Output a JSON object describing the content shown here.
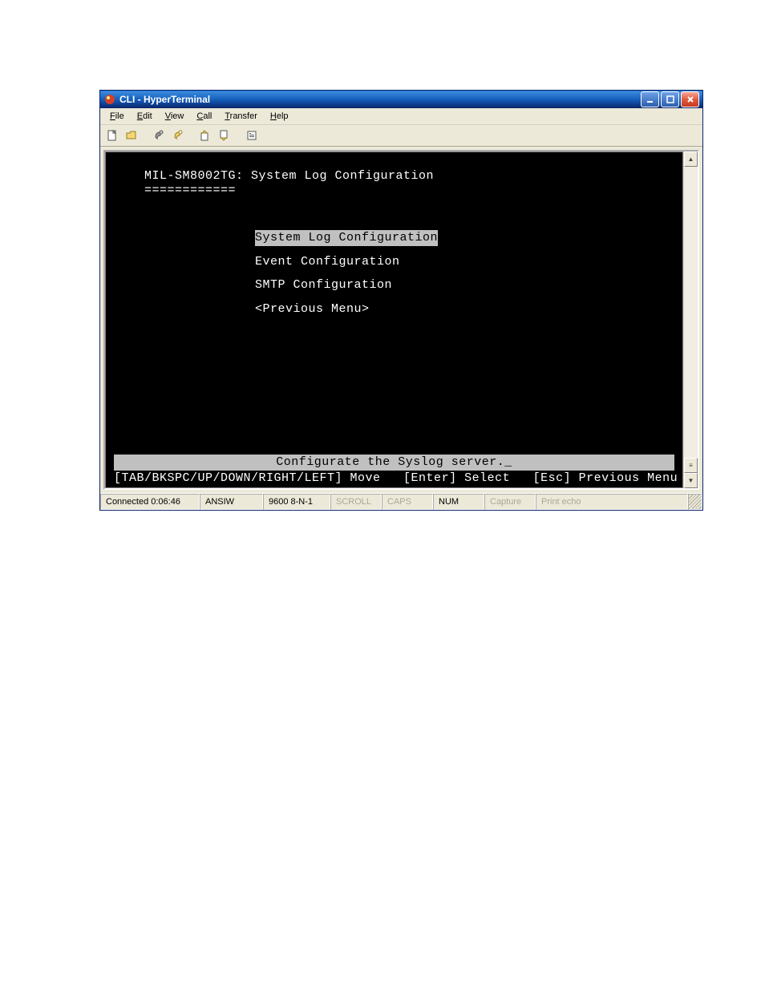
{
  "window": {
    "title": "CLI - HyperTerminal"
  },
  "menu": {
    "file": "File",
    "edit": "Edit",
    "view": "View",
    "call": "Call",
    "transfer": "Transfer",
    "help": "Help"
  },
  "terminal": {
    "header": "MIL-SM8002TG: System Log Configuration",
    "underline": "============",
    "items": [
      {
        "label": "System Log Configuration",
        "selected": true
      },
      {
        "label": "Event Configuration",
        "selected": false
      },
      {
        "label": "SMTP Configuration",
        "selected": false
      },
      {
        "label": "<Previous Menu>",
        "selected": false
      }
    ],
    "hint": "Configurate the Syslog server._",
    "nav": "[TAB/BKSPC/UP/DOWN/RIGHT/LEFT] Move   [Enter] Select   [Esc] Previous Menu"
  },
  "status": {
    "connected": "Connected 0:06:46",
    "encoding": "ANSIW",
    "params": "9600 8-N-1",
    "scroll": "SCROLL",
    "caps": "CAPS",
    "num": "NUM",
    "capture": "Capture",
    "printecho": "Print echo"
  }
}
